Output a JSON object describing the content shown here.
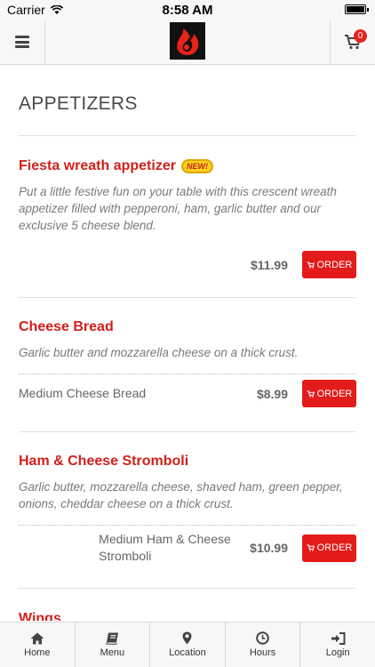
{
  "status_bar": {
    "carrier": "Carrier",
    "time": "8:58 AM"
  },
  "header": {
    "cart_count": "0",
    "logo": "flame-logo"
  },
  "menu": {
    "section_title": "APPETIZERS",
    "items": [
      {
        "name": "Fiesta wreath appetizer",
        "badge": "NEW!",
        "description": "Put a little festive fun on your table with this crescent wreath appetizer filled with pepperoni, ham, garlic butter and our exclusive 5 cheese blend.",
        "size": "",
        "price": "$11.99",
        "order_label": "ORDER"
      },
      {
        "name": "Cheese Bread",
        "description": "Garlic butter and mozzarella cheese on a thick crust.",
        "size": "Medium Cheese Bread",
        "price": "$8.99",
        "order_label": "ORDER"
      },
      {
        "name": "Ham & Cheese Stromboli",
        "description": "Garlic butter, mozzarella cheese, shaved ham, green pepper, onions, cheddar cheese on a thick crust.",
        "size": "Medium Ham & Cheese Stromboli",
        "price": "$10.99",
        "order_label": "ORDER"
      },
      {
        "name": "Wings"
      }
    ]
  },
  "tabs": [
    {
      "label": "Home",
      "icon": "home-icon"
    },
    {
      "label": "Menu",
      "icon": "book-icon"
    },
    {
      "label": "Location",
      "icon": "location-pin-icon"
    },
    {
      "label": "Hours",
      "icon": "clock-icon"
    },
    {
      "label": "Login",
      "icon": "login-icon"
    }
  ],
  "colors": {
    "accent": "#e41b1b",
    "title_red": "#d0201b",
    "bar_bg": "#f7f7f7"
  }
}
